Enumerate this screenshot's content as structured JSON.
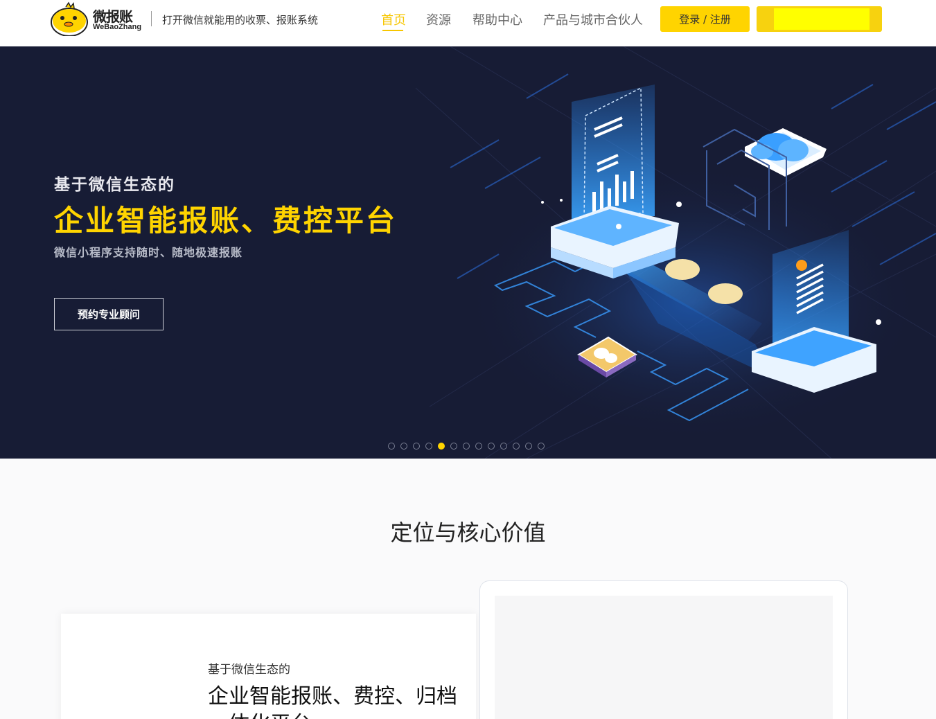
{
  "header": {
    "logo_cn": "微报账",
    "logo_en": "WeBaoZhang",
    "tagline": "打开微信就能用的收票、报账系统",
    "nav": [
      {
        "label": "首页",
        "active": true
      },
      {
        "label": "资源",
        "active": false
      },
      {
        "label": "帮助中心",
        "active": false
      },
      {
        "label": "产品与城市合伙人",
        "active": false
      }
    ],
    "login_label": "登录 / 注册",
    "accent_color": "#ffd400"
  },
  "hero": {
    "subtitle": "基于微信生态的",
    "title": "企业智能报账、费控平台",
    "description": "微信小程序支持随时、随地极速报账",
    "button_label": "预约专业顾问",
    "background_color": "#171c35",
    "carousel": {
      "total": 13,
      "active_index": 4
    }
  },
  "section": {
    "title": "定位与核心价值",
    "card": {
      "subtitle": "基于微信生态的",
      "title": "企业智能报账、费控、归档一体化平台"
    }
  }
}
